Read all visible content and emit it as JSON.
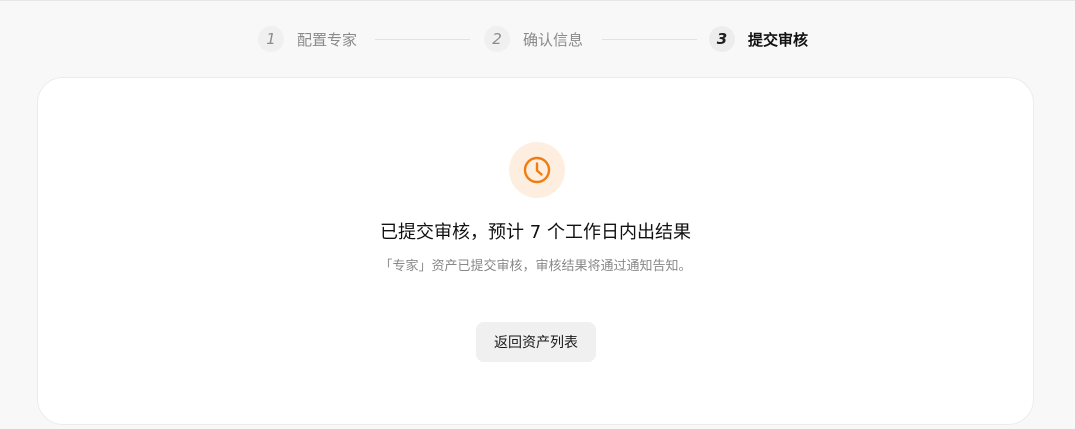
{
  "stepper": {
    "steps": [
      {
        "number": "1",
        "label": "配置专家",
        "state": "done"
      },
      {
        "number": "2",
        "label": "确认信息",
        "state": "done"
      },
      {
        "number": "3",
        "label": "提交审核",
        "state": "active"
      }
    ]
  },
  "result": {
    "icon": "clock-icon",
    "accent_color": "#f07d14",
    "icon_bg_color": "#fdeee0",
    "title": "已提交审核，预计 7 个工作日内出结果",
    "subtitle": "「专家」资产已提交审核，审核结果将通过通知告知。",
    "back_button_label": "返回资产列表"
  }
}
